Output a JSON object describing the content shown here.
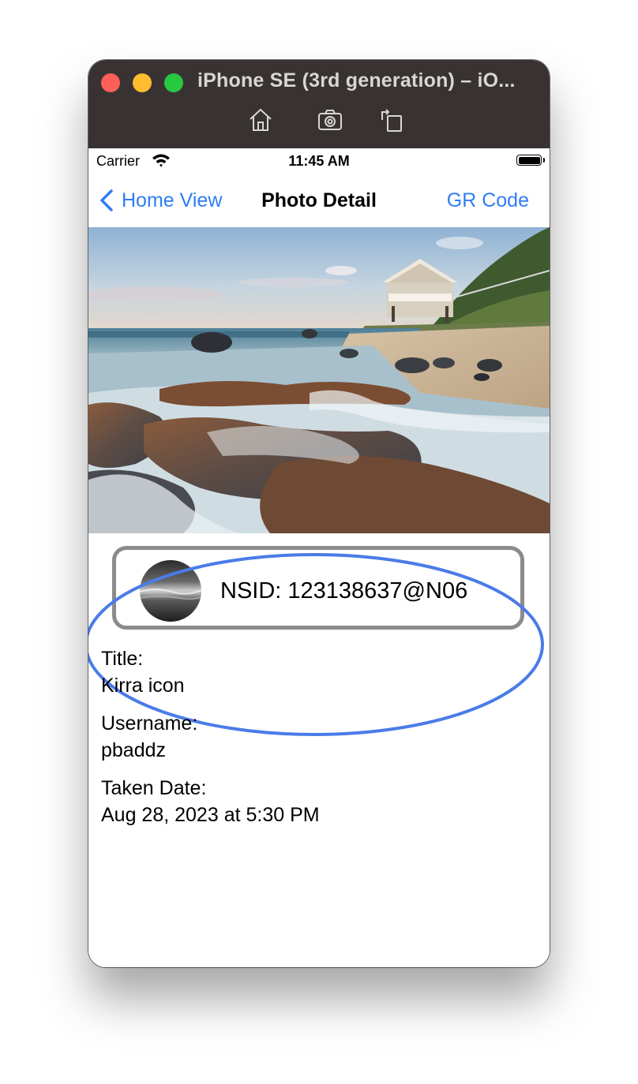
{
  "window": {
    "title": "iPhone SE (3rd generation) – iO...",
    "colors": {
      "titlebar": "#383332",
      "close": "#fe5f57",
      "minimize": "#febc2e",
      "zoom": "#28c840"
    },
    "toolbar_icons": [
      "home-icon",
      "screenshot-icon",
      "rotate-icon"
    ]
  },
  "status_bar": {
    "carrier": "Carrier",
    "time": "11:45 AM"
  },
  "nav": {
    "back_label": "Home View",
    "title": "Photo Detail",
    "right_label": "GR Code",
    "accent": "#2f7cf6"
  },
  "owner": {
    "nsid_label": "NSID: 123138637@N06"
  },
  "details": {
    "title_label": "Title:",
    "title_value": "Kirra icon",
    "username_label": "Username:",
    "username_value": "pbaddz",
    "date_label": "Taken Date:",
    "date_value": "Aug 28, 2023 at 5:30 PM"
  },
  "annotation": {
    "color": "#4a7ce8"
  }
}
